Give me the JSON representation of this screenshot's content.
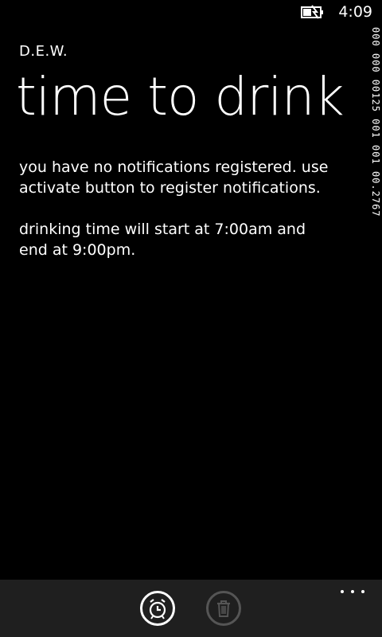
{
  "status_bar": {
    "time": "4:09",
    "battery_icon": "battery-charging-icon"
  },
  "perf_counter": {
    "text": "000 000 00125 001 001 00.2767"
  },
  "header": {
    "app_title": "D.E.W.",
    "page_title": "time to drink"
  },
  "content": {
    "paragraph_1": "you have no notifications registered.  use activate button to register notifications.",
    "paragraph_2": "drinking time will start at 7:00am and end at 9:00pm."
  },
  "app_bar": {
    "activate_icon": "alarm-clock-icon",
    "delete_icon": "trash-icon",
    "more_icon": "ellipsis-icon",
    "colors": {
      "background": "#1f1f1f",
      "enabled": "#ffffff",
      "disabled": "#555555"
    }
  }
}
